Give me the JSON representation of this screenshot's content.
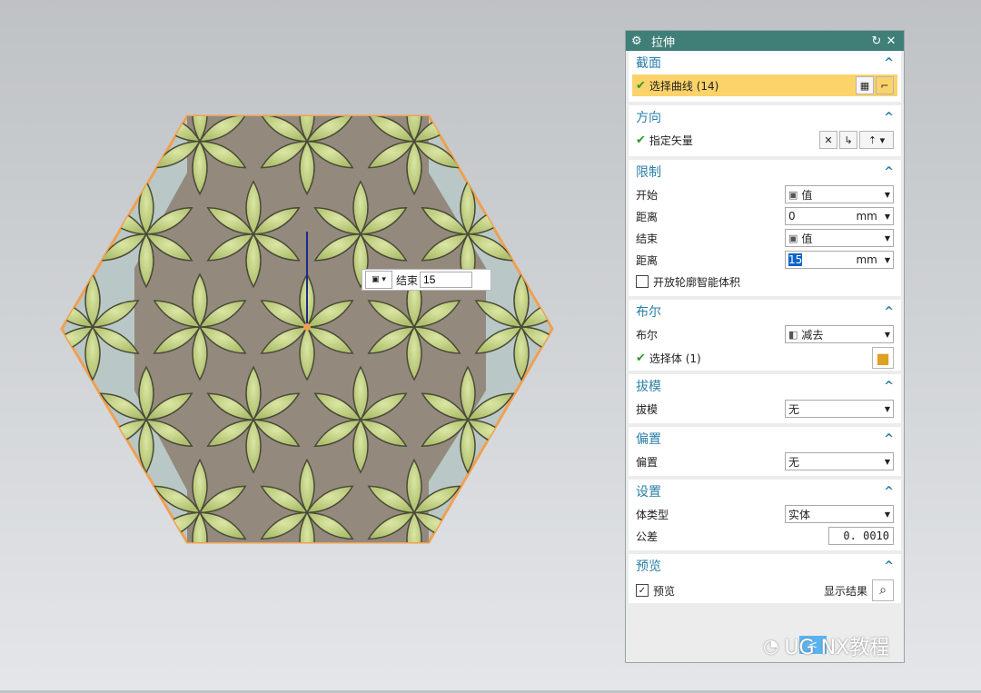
{
  "dialog": {
    "title": "拉伸",
    "reset_icon": "reset-icon",
    "close_icon": "close-icon",
    "section": {
      "header": "截面",
      "select_curve": "选择曲线 (14)"
    },
    "direction": {
      "header": "方向",
      "specify_vector": "指定矢量"
    },
    "limits": {
      "header": "限制",
      "start_label": "开始",
      "start_value": "值",
      "distance1_label": "距离",
      "distance1_value": "0",
      "unit1": "mm",
      "end_label": "结束",
      "end_value": "值",
      "distance2_label": "距离",
      "distance2_value": "15",
      "unit2": "mm",
      "open_profile": "开放轮廓智能体积"
    },
    "boolean": {
      "header": "布尔",
      "label": "布尔",
      "value": "减去",
      "select_body": "选择体 (1)"
    },
    "draft": {
      "header": "拔模",
      "label": "拔模",
      "value": "无"
    },
    "offset": {
      "header": "偏置",
      "label": "偏置",
      "value": "无"
    },
    "settings": {
      "header": "设置",
      "body_type_label": "体类型",
      "body_type_value": "实体",
      "tolerance_label": "公差",
      "tolerance_value": "0. 0010"
    },
    "preview": {
      "header": "预览",
      "preview_label": "预览",
      "show_result": "显示结果"
    }
  },
  "floating_input": {
    "label": "结束",
    "value": "15"
  },
  "watermark": "UG NX教程",
  "colors": {
    "titlebar": "#3f7f78",
    "section_header": "#2a7fa8",
    "selected_row": "#fcd36a",
    "leaf": "#c4d48a",
    "base": "#938a7d",
    "hex_edge": "#f0a050"
  }
}
